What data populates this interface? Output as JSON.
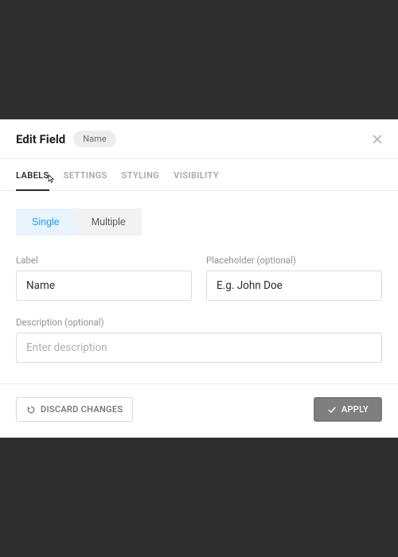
{
  "header": {
    "title": "Edit Field",
    "pill": "Name"
  },
  "tabs": {
    "items": [
      {
        "label": "LABELS"
      },
      {
        "label": "SETTINGS"
      },
      {
        "label": "STYLING"
      },
      {
        "label": "VISIBILITY"
      }
    ],
    "active_index": 0
  },
  "segmented": {
    "options": [
      {
        "label": "Single"
      },
      {
        "label": "Multiple"
      }
    ],
    "active_index": 0
  },
  "fields": {
    "label": {
      "caption": "Label",
      "value": "Name"
    },
    "placeholder": {
      "caption": "Placeholder (optional)",
      "value": "E.g. John Doe"
    },
    "description": {
      "caption": "Description (optional)",
      "value": "",
      "placeholder": "Enter description"
    }
  },
  "footer": {
    "discard": "DISCARD CHANGES",
    "apply": "APPLY"
  },
  "icons": {
    "close": "close-icon",
    "undo": "undo-icon",
    "check": "check-icon",
    "cursor": "pointer-cursor-icon"
  },
  "colors": {
    "backdrop": "#2e2e2e",
    "accent": "#1e9cf0",
    "border": "#dcdcdc",
    "tab_border": "#ececec",
    "apply_bg": "#7f7f7f"
  }
}
